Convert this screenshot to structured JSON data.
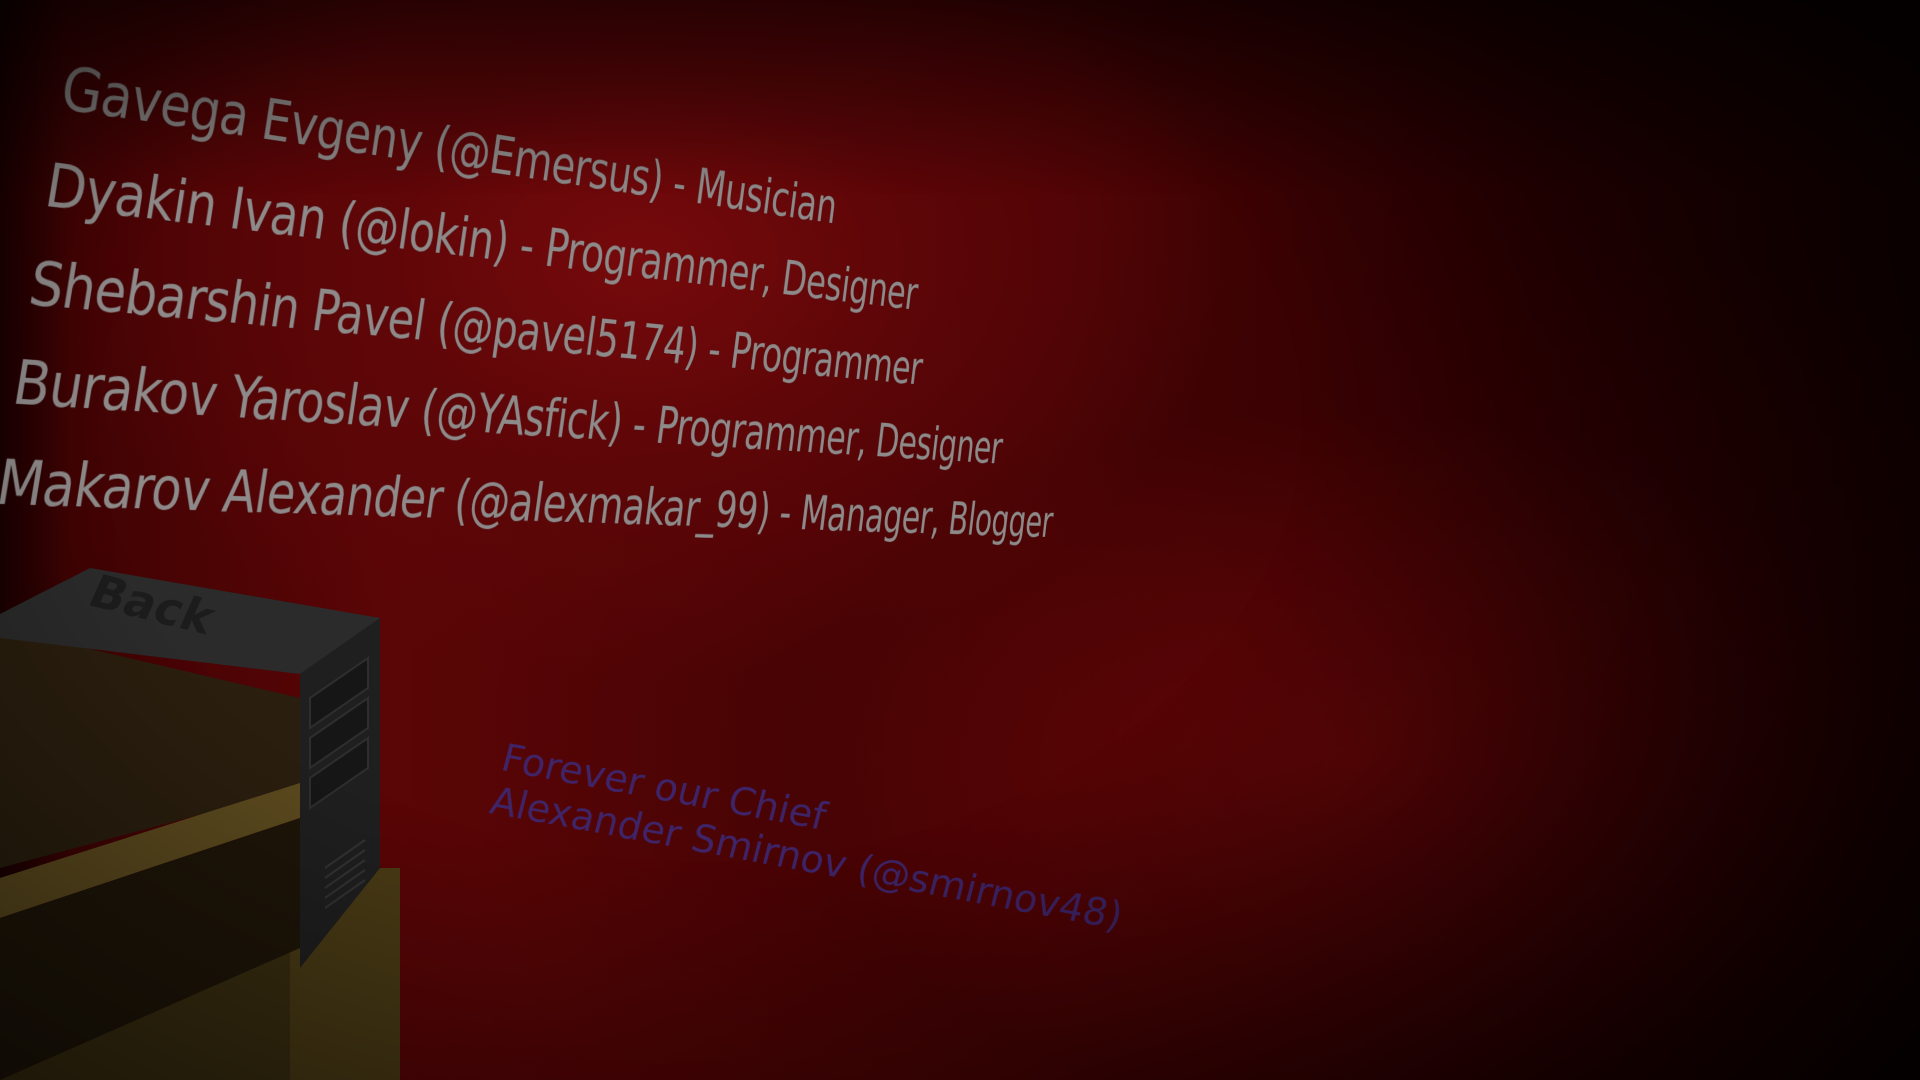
{
  "credits": [
    {
      "text": "Gavega Evgeny (@Emersus) - Musician"
    },
    {
      "text": "Dyakin Ivan (@lokin) - Programmer, Designer"
    },
    {
      "text": "Shebarshin Pavel (@pavel5174) - Programmer"
    },
    {
      "text": "Burakov Yaroslav (@YAsfick) - Programmer, Designer"
    },
    {
      "text": "Makarov Alexander (@alexmakar_99) - Manager, Blogger"
    }
  ],
  "dedication": {
    "line1": "Forever our Chief",
    "line2": "Alexander Smirnov (@smirnov48)"
  },
  "back_button": {
    "label": "Back"
  },
  "colors": {
    "wall": "#5a0506",
    "credit_text": "#8f8a8a",
    "dedication_text": "#3b2a7a",
    "desk": "#5c4a1e"
  }
}
